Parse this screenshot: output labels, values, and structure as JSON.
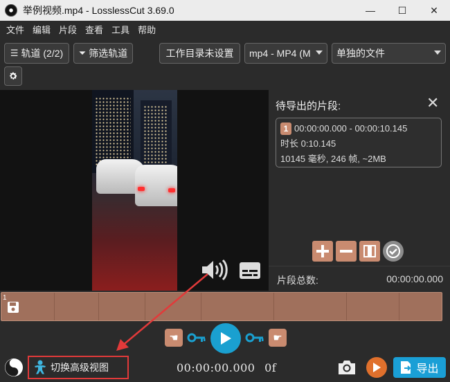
{
  "window": {
    "title": "举例视频.mp4 - LosslessCut 3.69.0",
    "minimize": "—",
    "maximize": "☐",
    "close": "✕"
  },
  "menu": [
    "文件",
    "编辑",
    "片段",
    "查看",
    "工具",
    "帮助"
  ],
  "toolbar": {
    "tracks_label": "轨道 (2/2)",
    "filter_tracks_label": "筛选轨道",
    "workdir_label": "工作目录未设置",
    "format_select": "mp4 - MP4 (M",
    "output_mode_select": "单独的文件"
  },
  "segments": {
    "title": "待导出的片段:",
    "items": [
      {
        "number": "1",
        "range": "00:00:00.000 - 00:00:10.145",
        "duration": "时长 0:10.145",
        "details": "10145 毫秒, 246 帧, ~2MB"
      }
    ],
    "total_label": "片段总数:",
    "total_value": "00:00:00.000"
  },
  "timeline": {
    "marker": "1"
  },
  "controls": {
    "advanced_view_label": "切换高级视图",
    "timecode": "00:00:00.000",
    "frame": "0f",
    "export_label": "导出"
  },
  "colors": {
    "accent_blue": "#1aa0d0",
    "segment_brown": "#c98b70",
    "timeline_brown": "#a0705c",
    "annotation_red": "#e23a3a",
    "record_orange": "#e0702c"
  },
  "icons": [
    "tracks-icon",
    "filter-icon",
    "gear-icon",
    "volume-icon",
    "subtitle-icon",
    "close-icon",
    "add-icon",
    "remove-icon",
    "split-icon",
    "check-icon",
    "save-icon",
    "hand-left-icon",
    "key-left-icon",
    "play-icon",
    "key-right-icon",
    "hand-right-icon",
    "yinyang-icon",
    "person-icon",
    "camera-icon",
    "record-icon",
    "export-icon"
  ]
}
